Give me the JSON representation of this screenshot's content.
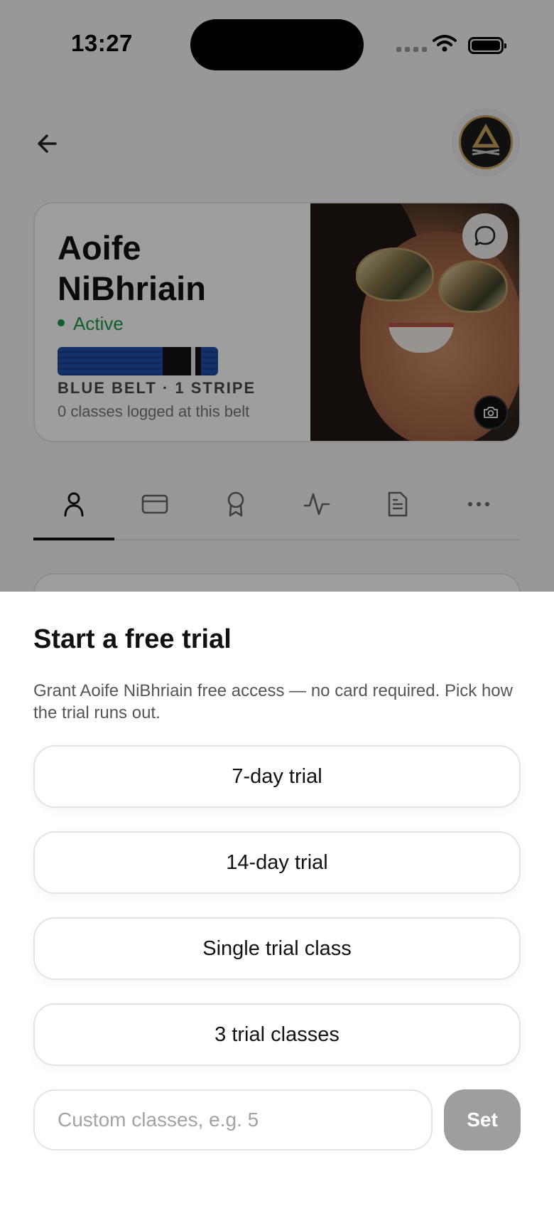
{
  "status_bar": {
    "time": "13:27"
  },
  "header": {
    "back_icon": "arrow-left-icon",
    "logo_icon": "gym-logo"
  },
  "profile": {
    "first_name": "Aoife",
    "last_name": "NiBhriain",
    "status": "Active",
    "status_color": "#1e9a48",
    "belt_color": "#1f4fa8",
    "belt_title": "BLUE BELT · 1 STRIPE",
    "belt_subtitle": "0 classes logged at this belt",
    "stripes": 1
  },
  "tabs": [
    {
      "icon": "person-icon",
      "active": true
    },
    {
      "icon": "card-icon",
      "active": false
    },
    {
      "icon": "award-icon",
      "active": false
    },
    {
      "icon": "activity-icon",
      "active": false
    },
    {
      "icon": "document-icon",
      "active": false
    },
    {
      "icon": "more-icon",
      "active": false
    }
  ],
  "sheet": {
    "title": "Start a free trial",
    "description": "Grant Aoife NiBhriain free access — no card required. Pick how the trial runs out.",
    "options": [
      "7-day trial",
      "14-day trial",
      "Single trial class",
      "3 trial classes"
    ],
    "custom_placeholder": "Custom classes, e.g. 5",
    "custom_value": "",
    "set_label": "Set"
  }
}
